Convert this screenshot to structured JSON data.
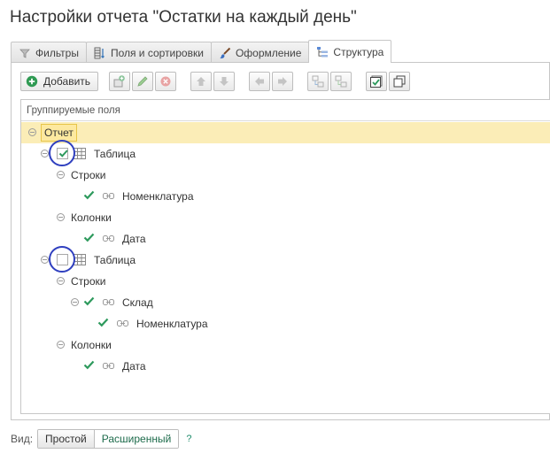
{
  "title": "Настройки отчета \"Остатки на каждый день\"",
  "tabs": [
    {
      "label": "Фильтры",
      "icon": "filter-icon",
      "active": false
    },
    {
      "label": "Поля и сортировки",
      "icon": "fields-icon",
      "active": false
    },
    {
      "label": "Оформление",
      "icon": "brush-icon",
      "active": false
    },
    {
      "label": "Структура",
      "icon": "structure-icon",
      "active": true
    }
  ],
  "toolbar": {
    "add_label": "Добавить",
    "buttons": [
      "add-icon",
      "add-group-icon",
      "edit-icon",
      "delete-icon",
      "move-up-icon",
      "move-down-icon",
      "move-left-icon",
      "move-right-icon",
      "group-icon",
      "ungroup-icon",
      "check-all-icon",
      "copy-icon"
    ]
  },
  "tree": {
    "header": "Группируемые поля",
    "nodes": [
      {
        "label": "Отчет",
        "checkbox": null,
        "icon": null,
        "selected": true
      },
      {
        "label": "Таблица",
        "checkbox": true,
        "icon": "table-icon",
        "highlighted": true
      },
      {
        "label": "Строки",
        "checkbox": null,
        "icon": null
      },
      {
        "label": "Номенклатура",
        "checkbox": true,
        "icon": "link-icon"
      },
      {
        "label": "Колонки",
        "checkbox": null,
        "icon": null
      },
      {
        "label": "Дата",
        "checkbox": true,
        "icon": "link-icon"
      },
      {
        "label": "Таблица",
        "checkbox": false,
        "icon": "table-icon",
        "highlighted": true
      },
      {
        "label": "Строки",
        "checkbox": null,
        "icon": null
      },
      {
        "label": "Склад",
        "checkbox": true,
        "icon": "link-icon"
      },
      {
        "label": "Номенклатура",
        "checkbox": true,
        "icon": "link-icon"
      },
      {
        "label": "Колонки",
        "checkbox": null,
        "icon": null
      },
      {
        "label": "Дата",
        "checkbox": true,
        "icon": "link-icon"
      }
    ]
  },
  "footer": {
    "view_label": "Вид:",
    "simple": "Простой",
    "extended": "Расширенный",
    "help": "?"
  },
  "colors": {
    "selection": "#fbedb7",
    "check": "#2e9a5d",
    "highlight_circle": "#2f3fbf"
  }
}
